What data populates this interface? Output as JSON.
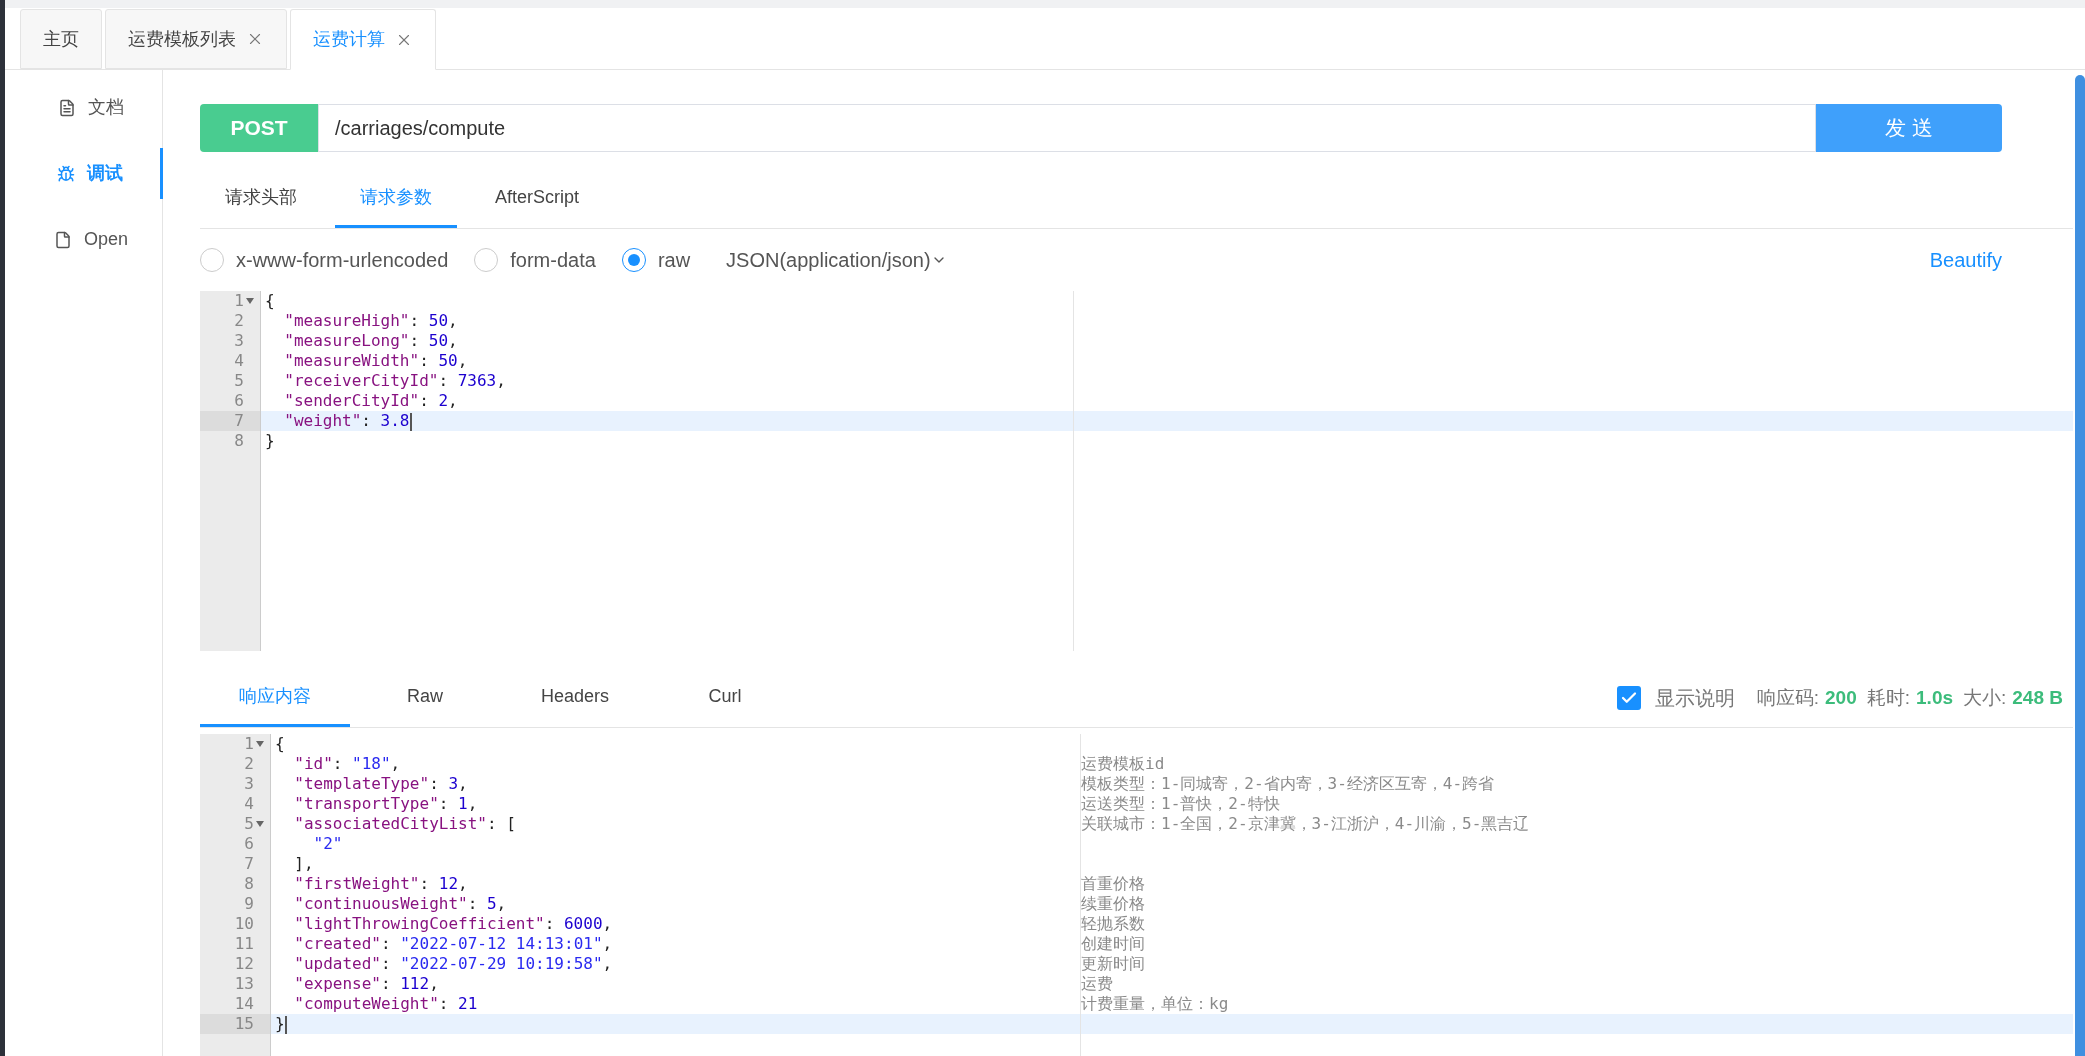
{
  "tabs": [
    {
      "label": "主页",
      "closable": false,
      "selected": false
    },
    {
      "label": "运费模板列表",
      "closable": true,
      "selected": false
    },
    {
      "label": "运费计算",
      "closable": true,
      "selected": true
    }
  ],
  "sidebar": {
    "items": [
      {
        "label": "文档",
        "kind": "doc",
        "selected": false
      },
      {
        "label": "调试",
        "kind": "bug",
        "selected": true
      },
      {
        "label": "Open",
        "kind": "file",
        "selected": false
      }
    ]
  },
  "request": {
    "method": "POST",
    "url": "/carriages/compute",
    "send": "发 送",
    "tabs": [
      {
        "label": "请求头部",
        "selected": false
      },
      {
        "label": "请求参数",
        "selected": true
      },
      {
        "label": "AfterScript",
        "selected": false
      }
    ],
    "body_types": [
      {
        "label": "x-www-form-urlencoded",
        "selected": false
      },
      {
        "label": "form-data",
        "selected": false
      },
      {
        "label": "raw",
        "selected": true
      }
    ],
    "content_type": "JSON(application/json)",
    "beautify": "Beautify",
    "lines": [
      {
        "number": "1",
        "fold": true,
        "active": false,
        "tokens": [
          {
            "kind": "punct",
            "text": "{"
          }
        ]
      },
      {
        "number": "2",
        "fold": false,
        "active": false,
        "tokens": [
          {
            "kind": "key",
            "text": "  \"measureHigh\""
          },
          {
            "kind": "punct",
            "text": ": "
          },
          {
            "kind": "number",
            "text": "50"
          },
          {
            "kind": "punct",
            "text": ","
          }
        ]
      },
      {
        "number": "3",
        "fold": false,
        "active": false,
        "tokens": [
          {
            "kind": "key",
            "text": "  \"measureLong\""
          },
          {
            "kind": "punct",
            "text": ": "
          },
          {
            "kind": "number",
            "text": "50"
          },
          {
            "kind": "punct",
            "text": ","
          }
        ]
      },
      {
        "number": "4",
        "fold": false,
        "active": false,
        "tokens": [
          {
            "kind": "key",
            "text": "  \"measureWidth\""
          },
          {
            "kind": "punct",
            "text": ": "
          },
          {
            "kind": "number",
            "text": "50"
          },
          {
            "kind": "punct",
            "text": ","
          }
        ]
      },
      {
        "number": "5",
        "fold": false,
        "active": false,
        "tokens": [
          {
            "kind": "key",
            "text": "  \"receiverCityId\""
          },
          {
            "kind": "punct",
            "text": ": "
          },
          {
            "kind": "number",
            "text": "7363"
          },
          {
            "kind": "punct",
            "text": ","
          }
        ]
      },
      {
        "number": "6",
        "fold": false,
        "active": false,
        "tokens": [
          {
            "kind": "key",
            "text": "  \"senderCityId\""
          },
          {
            "kind": "punct",
            "text": ": "
          },
          {
            "kind": "number",
            "text": "2"
          },
          {
            "kind": "punct",
            "text": ","
          }
        ]
      },
      {
        "number": "7",
        "fold": false,
        "active": true,
        "tokens": [
          {
            "kind": "key",
            "text": "  \"weight\""
          },
          {
            "kind": "punct",
            "text": ": "
          },
          {
            "kind": "number",
            "text": "3.8"
          }
        ]
      },
      {
        "number": "8",
        "fold": false,
        "active": false,
        "tokens": [
          {
            "kind": "punct",
            "text": "}"
          }
        ]
      }
    ]
  },
  "response": {
    "tabs": [
      {
        "label": "响应内容",
        "selected": true
      },
      {
        "label": "Raw",
        "selected": false
      },
      {
        "label": "Headers",
        "selected": false
      },
      {
        "label": "Curl",
        "selected": false
      }
    ],
    "show_notes": {
      "label": "显示说明",
      "checked": true
    },
    "stats": [
      {
        "label": "响应码:",
        "value": "200"
      },
      {
        "label": "耗时:",
        "value": "1.0s"
      },
      {
        "label": "大小:",
        "value": "248 B"
      }
    ],
    "lines": [
      {
        "number": "1",
        "fold": true,
        "active": false,
        "tokens": [
          {
            "kind": "punct",
            "text": "{"
          }
        ]
      },
      {
        "number": "2",
        "fold": false,
        "active": false,
        "tokens": [
          {
            "kind": "key",
            "text": "  \"id\""
          },
          {
            "kind": "punct",
            "text": ": "
          },
          {
            "kind": "string",
            "text": "\"18\""
          },
          {
            "kind": "punct",
            "text": ","
          }
        ],
        "comment": "运费模板id"
      },
      {
        "number": "3",
        "fold": false,
        "active": false,
        "tokens": [
          {
            "kind": "key",
            "text": "  \"templateType\""
          },
          {
            "kind": "punct",
            "text": ": "
          },
          {
            "kind": "number",
            "text": "3"
          },
          {
            "kind": "punct",
            "text": ","
          }
        ],
        "comment": "模板类型：1-同城寄，2-省内寄，3-经济区互寄，4-跨省"
      },
      {
        "number": "4",
        "fold": false,
        "active": false,
        "tokens": [
          {
            "kind": "key",
            "text": "  \"transportType\""
          },
          {
            "kind": "punct",
            "text": ": "
          },
          {
            "kind": "number",
            "text": "1"
          },
          {
            "kind": "punct",
            "text": ","
          }
        ],
        "comment": "运送类型：1-普快，2-特快"
      },
      {
        "number": "5",
        "fold": true,
        "active": false,
        "tokens": [
          {
            "kind": "key",
            "text": "  \"associatedCityList\""
          },
          {
            "kind": "punct",
            "text": ": ["
          }
        ],
        "comment": "关联城市：1-全国，2-京津冀，3-江浙沪，4-川渝，5-黑吉辽"
      },
      {
        "number": "6",
        "fold": false,
        "active": false,
        "tokens": [
          {
            "kind": "string",
            "text": "    \"2\""
          }
        ]
      },
      {
        "number": "7",
        "fold": false,
        "active": false,
        "tokens": [
          {
            "kind": "punct",
            "text": "  ],"
          }
        ]
      },
      {
        "number": "8",
        "fold": false,
        "active": false,
        "tokens": [
          {
            "kind": "key",
            "text": "  \"firstWeight\""
          },
          {
            "kind": "punct",
            "text": ": "
          },
          {
            "kind": "number",
            "text": "12"
          },
          {
            "kind": "punct",
            "text": ","
          }
        ],
        "comment": "首重价格"
      },
      {
        "number": "9",
        "fold": false,
        "active": false,
        "tokens": [
          {
            "kind": "key",
            "text": "  \"continuousWeight\""
          },
          {
            "kind": "punct",
            "text": ": "
          },
          {
            "kind": "number",
            "text": "5"
          },
          {
            "kind": "punct",
            "text": ","
          }
        ],
        "comment": "续重价格"
      },
      {
        "number": "10",
        "fold": false,
        "active": false,
        "tokens": [
          {
            "kind": "key",
            "text": "  \"lightThrowingCoefficient\""
          },
          {
            "kind": "punct",
            "text": ": "
          },
          {
            "kind": "number",
            "text": "6000"
          },
          {
            "kind": "punct",
            "text": ","
          }
        ],
        "comment": "轻抛系数"
      },
      {
        "number": "11",
        "fold": false,
        "active": false,
        "tokens": [
          {
            "kind": "key",
            "text": "  \"created\""
          },
          {
            "kind": "punct",
            "text": ": "
          },
          {
            "kind": "string",
            "text": "\"2022-07-12 14:13:01\""
          },
          {
            "kind": "punct",
            "text": ","
          }
        ],
        "comment": "创建时间"
      },
      {
        "number": "12",
        "fold": false,
        "active": false,
        "tokens": [
          {
            "kind": "key",
            "text": "  \"updated\""
          },
          {
            "kind": "punct",
            "text": ": "
          },
          {
            "kind": "string",
            "text": "\"2022-07-29 10:19:58\""
          },
          {
            "kind": "punct",
            "text": ","
          }
        ],
        "comment": "更新时间"
      },
      {
        "number": "13",
        "fold": false,
        "active": false,
        "tokens": [
          {
            "kind": "key",
            "text": "  \"expense\""
          },
          {
            "kind": "punct",
            "text": ": "
          },
          {
            "kind": "number",
            "text": "112"
          },
          {
            "kind": "punct",
            "text": ","
          }
        ],
        "comment": "运费"
      },
      {
        "number": "14",
        "fold": false,
        "active": false,
        "tokens": [
          {
            "kind": "key",
            "text": "  \"computeWeight\""
          },
          {
            "kind": "punct",
            "text": ": "
          },
          {
            "kind": "number",
            "text": "21"
          }
        ],
        "comment": "计费重量，单位：kg"
      },
      {
        "number": "15",
        "fold": false,
        "active": true,
        "tokens": [
          {
            "kind": "punct",
            "text": "}"
          }
        ]
      }
    ]
  }
}
